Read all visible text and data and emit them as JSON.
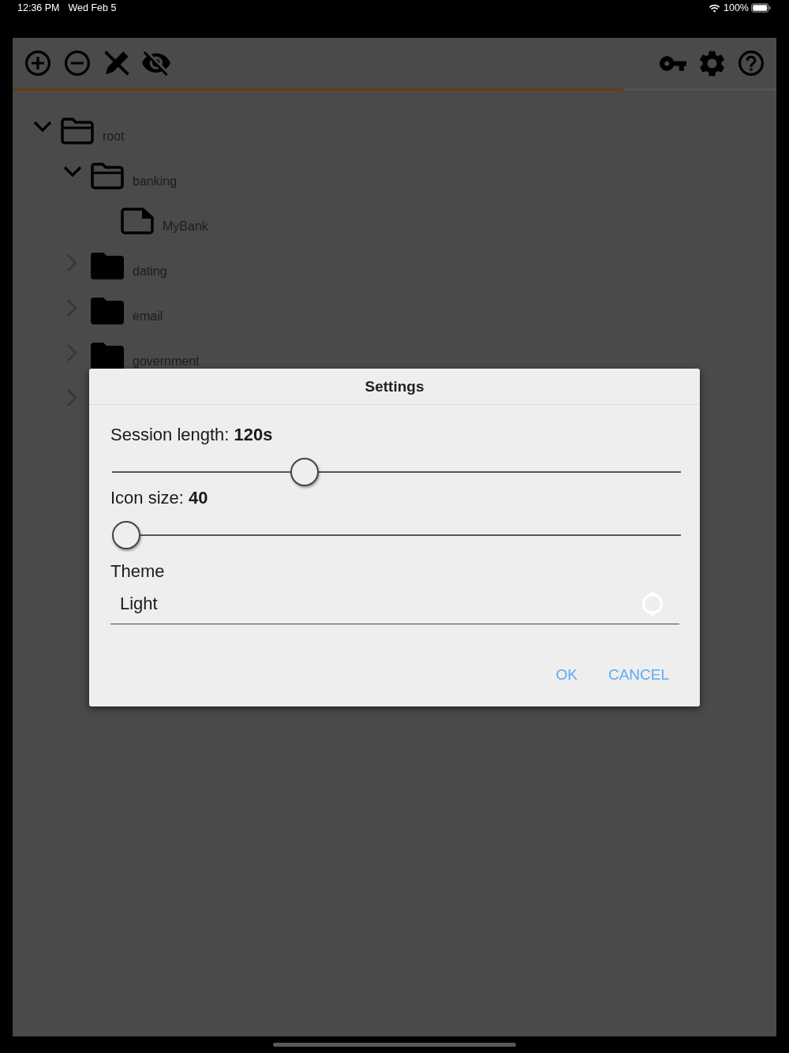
{
  "status_bar": {
    "time": "12:36 PM",
    "date": "Wed Feb 5",
    "battery": "100%"
  },
  "progress_bar": {
    "level": 0.8
  },
  "tree": [
    {
      "label": "root",
      "kind": "folder",
      "expanded": true,
      "children": [
        {
          "label": "banking",
          "kind": "folder",
          "expanded": true,
          "children": [
            {
              "label": "MyBank",
              "kind": "file"
            }
          ]
        },
        {
          "label": "dating",
          "kind": "folder",
          "expanded": false
        },
        {
          "label": "email",
          "kind": "folder",
          "expanded": false
        },
        {
          "label": "government",
          "kind": "folder",
          "expanded": false
        },
        {
          "expanded": false
        }
      ]
    }
  ],
  "dialog": {
    "title": "Settings",
    "sliders": [
      {
        "label": "Session length: **120s**",
        "level": 0.33
      },
      {
        "label": "Icon size: **40**",
        "level": 0
      }
    ],
    "theme": {
      "label": "Theme",
      "value": "Light"
    },
    "buttons": [
      "OK",
      "CANCEL"
    ]
  }
}
